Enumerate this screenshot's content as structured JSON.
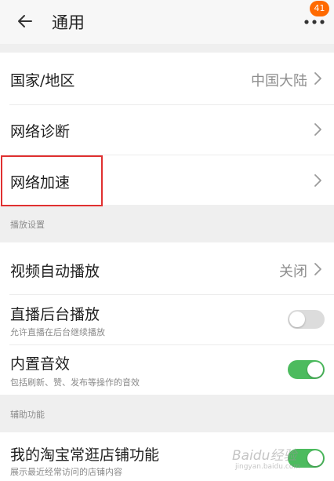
{
  "header": {
    "title": "通用",
    "badge_count": "41"
  },
  "region": {
    "label": "国家/地区",
    "value": "中国大陆"
  },
  "network_diagnose": {
    "label": "网络诊断"
  },
  "network_accelerate": {
    "label": "网络加速"
  },
  "playback_group": {
    "title": "播放设置"
  },
  "video_autoplay": {
    "label": "视频自动播放",
    "value": "关闭"
  },
  "live_background": {
    "label": "直播后台播放",
    "sub": "允许直播在后台继续播放",
    "enabled": false
  },
  "builtin_sound": {
    "label": "内置音效",
    "sub": "包括刷新、赞、发布等操作的音效",
    "enabled": true
  },
  "assist_group": {
    "title": "辅助功能"
  },
  "shop_feature": {
    "label": "我的淘宝常逛店铺功能",
    "sub": "展示最近经常访问的店铺内容",
    "enabled": true
  },
  "watermark": {
    "text": "Baidu经验",
    "sub": "jingyan.baidu.com"
  },
  "colors": {
    "accent_badge": "#ff6a00",
    "toggle_on": "#4cbb5e",
    "toggle_off": "#dcdcdc",
    "highlight_box": "#e03030"
  }
}
